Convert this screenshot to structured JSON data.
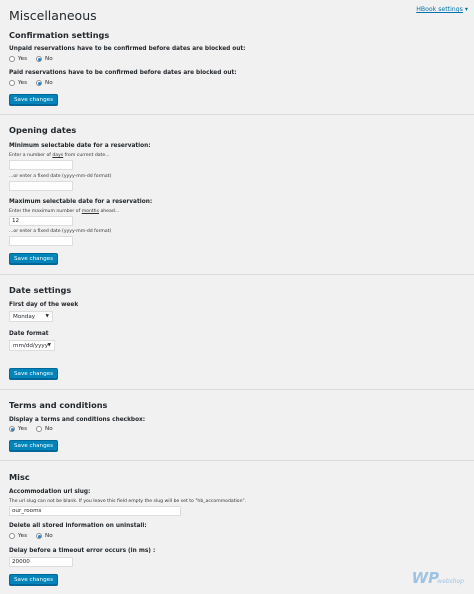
{
  "page": {
    "title": "Miscellaneous",
    "settings_link": "HBook settings",
    "caret": "▾"
  },
  "confirmation": {
    "title": "Confirmation settings",
    "unpaid_label": "Unpaid reservations have to be confirmed before dates are blocked out:",
    "paid_label": "Paid reservations have to be confirmed before dates are blocked out:",
    "yes": "Yes",
    "no": "No",
    "save": "Save changes"
  },
  "opening": {
    "title": "Opening dates",
    "min_label": "Minimum selectable date for a reservation:",
    "min_help_pre": "Enter a number of ",
    "min_help_unit": "days",
    "min_help_post": " from current date...",
    "min_value": "",
    "or_fixed": "...or enter a fixed date (yyyy-mm-dd format)",
    "max_label": "Maximum selectable date for a reservation:",
    "max_help_pre": "Enter the maximum number of ",
    "max_help_unit": "months",
    "max_help_post": " ahead...",
    "max_value": "12",
    "save": "Save changes"
  },
  "date": {
    "title": "Date settings",
    "first_day_label": "First day of the week",
    "first_day_value": "Monday",
    "format_label": "Date format",
    "format_value": "mm/dd/yyyy",
    "save": "Save changes"
  },
  "terms": {
    "title": "Terms and conditions",
    "display_label": "Display a terms and conditions checkbox:",
    "yes": "Yes",
    "no": "No",
    "save": "Save changes"
  },
  "misc": {
    "title": "Misc",
    "slug_label": "Accommodation url slug:",
    "slug_help": "The url slug can not be blank. If you leave this field empty the slug will be set to \"hb_accommodation\".",
    "slug_value": "our_rooms",
    "delete_label": "Delete all stored information on uninstall:",
    "yes": "Yes",
    "no": "No",
    "timeout_label": "Delay before a timeout error occurs (in ms) :",
    "timeout_value": "20000",
    "save": "Save changes"
  },
  "watermark": {
    "logo": "WP",
    "sub": "webshop"
  }
}
